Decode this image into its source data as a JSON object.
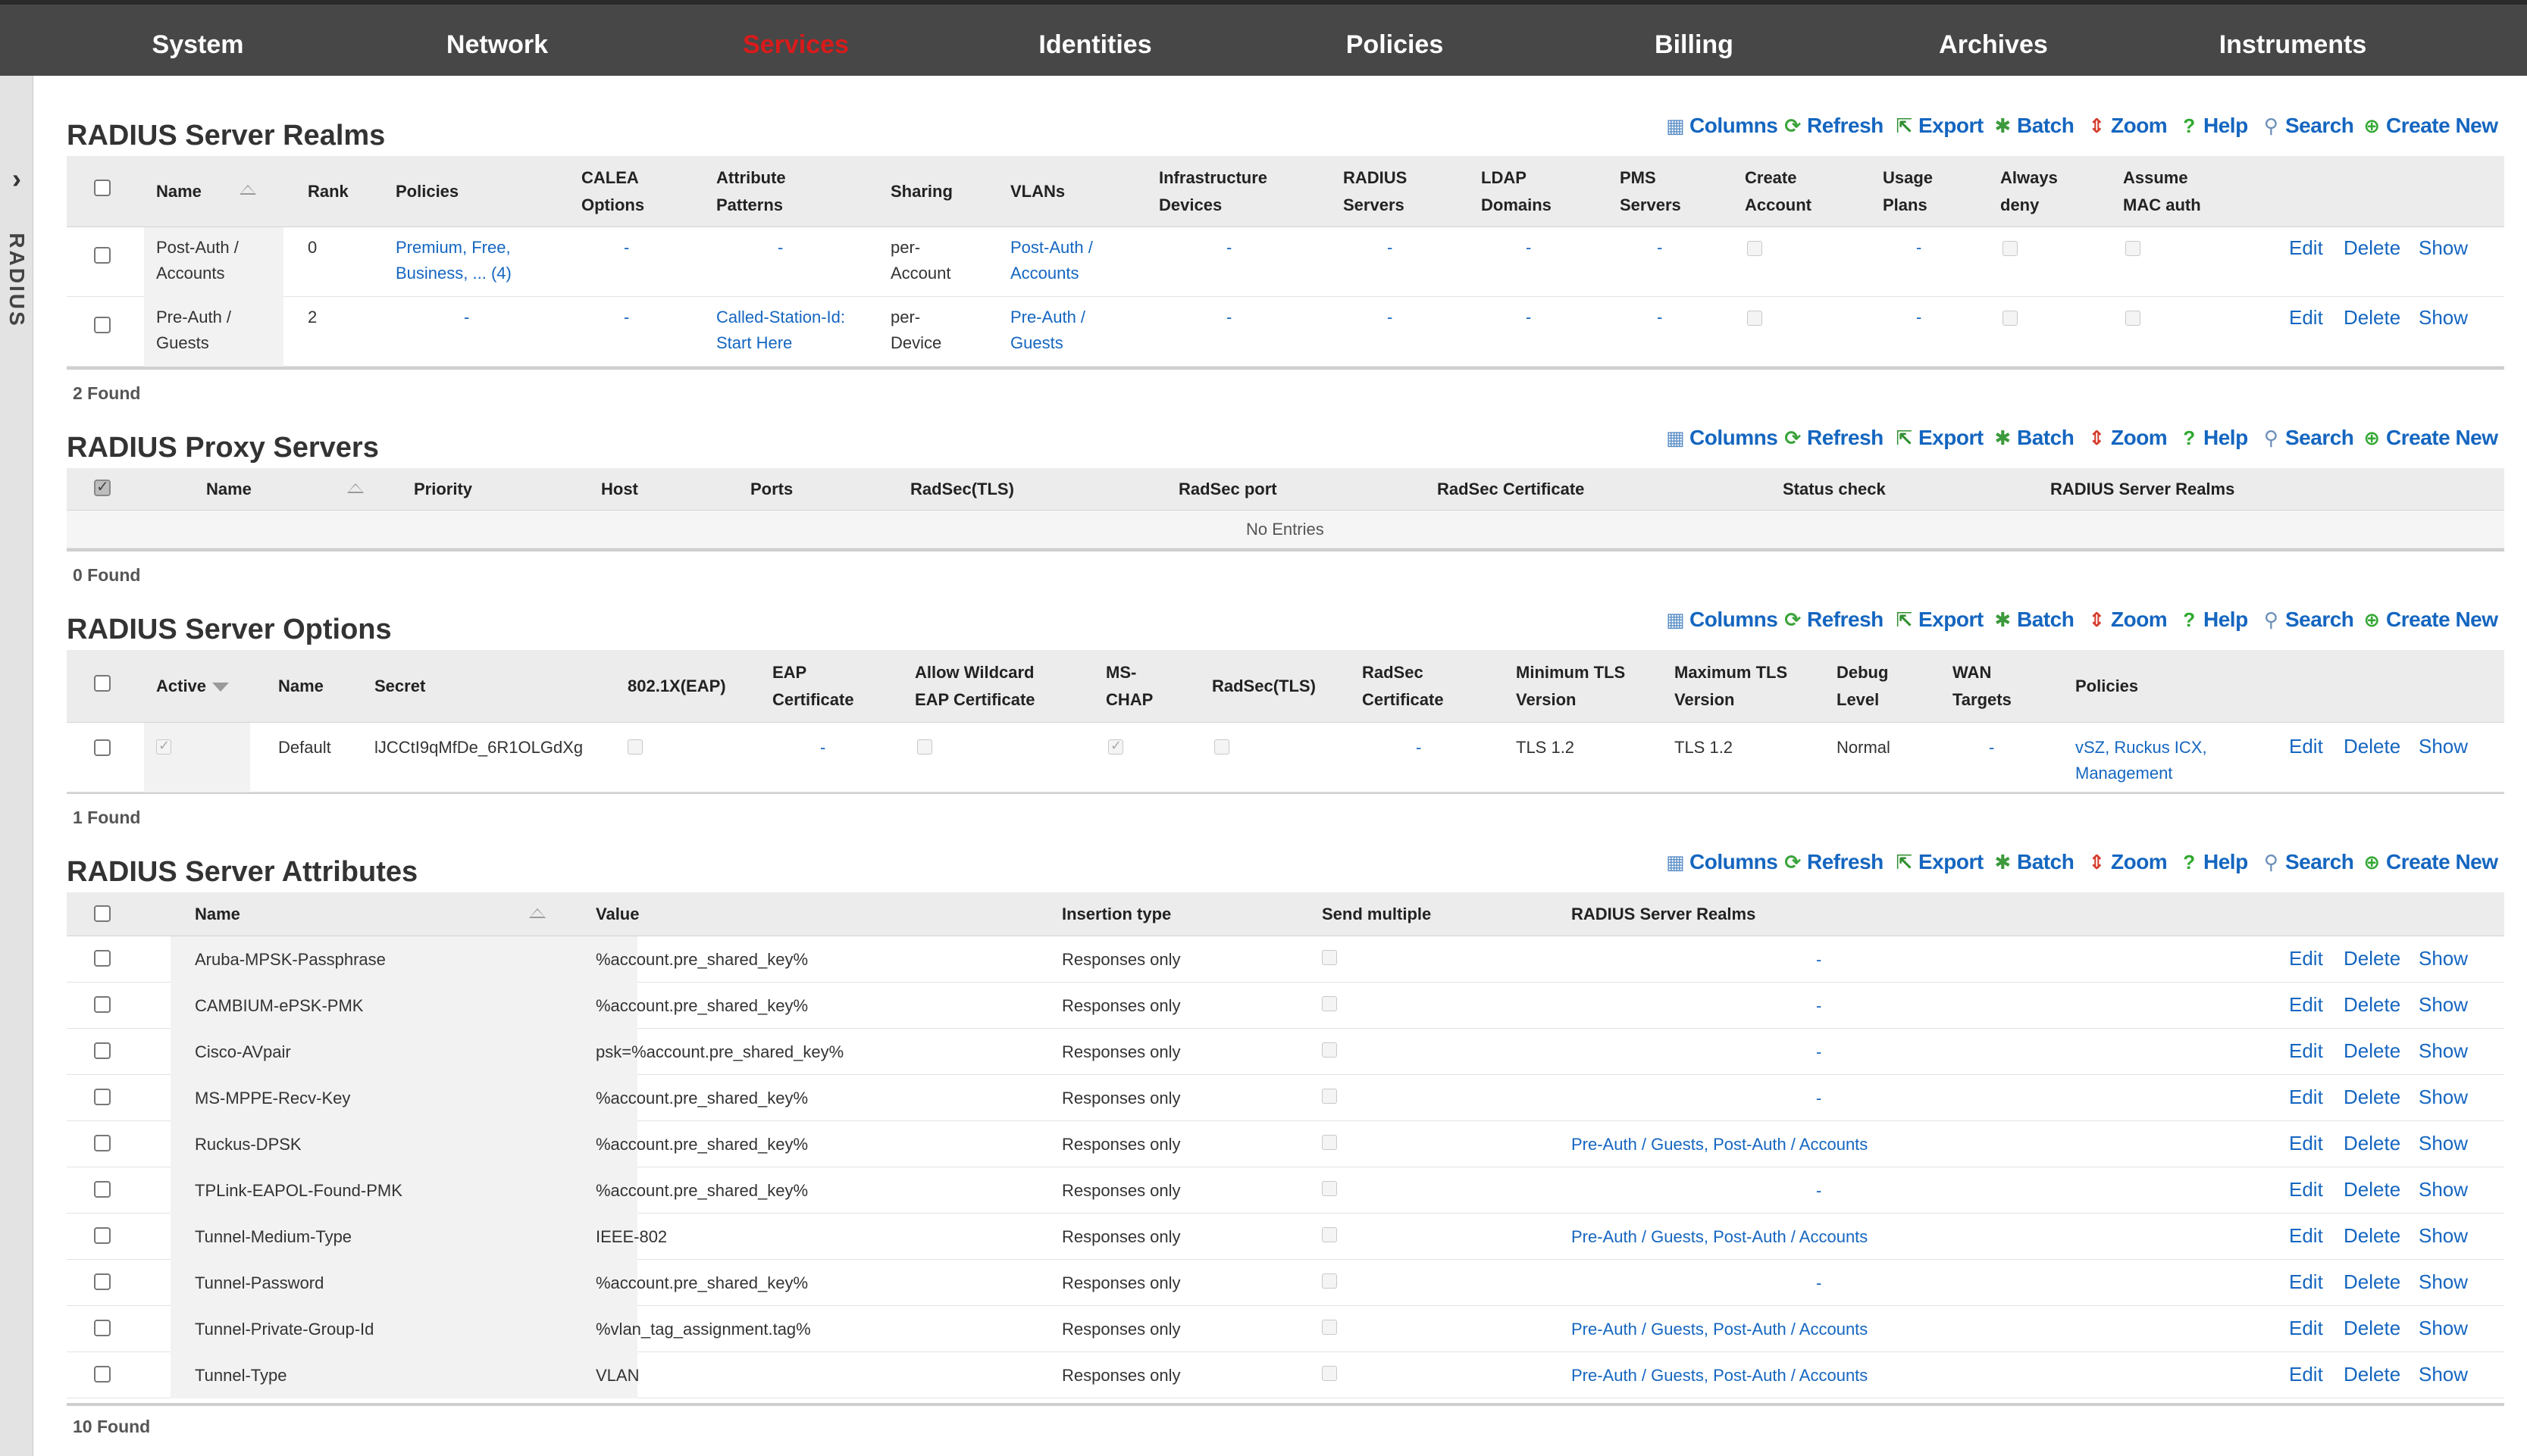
{
  "nav": [
    "System",
    "Network",
    "Services",
    "Identities",
    "Policies",
    "Billing",
    "Archives",
    "Instruments"
  ],
  "nav_active": "Services",
  "sidetab": {
    "label": "RADIUS"
  },
  "toolbar": {
    "columns": "Columns",
    "refresh": "Refresh",
    "export": "Export",
    "batch": "Batch",
    "zoom": "Zoom",
    "help": "Help",
    "search": "Search",
    "create_new": "Create New"
  },
  "actions": {
    "edit": "Edit",
    "delete": "Delete",
    "show": "Show"
  },
  "realms": {
    "title": "RADIUS Server Realms",
    "headers": {
      "name": "Name",
      "rank": "Rank",
      "policies": "Policies",
      "calea_1": "CALEA",
      "calea_2": "Options",
      "attr_1": "Attribute",
      "attr_2": "Patterns",
      "sharing": "Sharing",
      "vlans": "VLANs",
      "infra_1": "Infrastructure",
      "infra_2": "Devices",
      "radius_1": "RADIUS",
      "radius_2": "Servers",
      "ldap_1": "LDAP",
      "ldap_2": "Domains",
      "pms_1": "PMS",
      "pms_2": "Servers",
      "create_1": "Create",
      "create_2": "Account",
      "usage_1": "Usage",
      "usage_2": "Plans",
      "always_1": "Always",
      "always_2": "deny",
      "assume_1": "Assume",
      "assume_2": "MAC auth"
    },
    "rows": [
      {
        "name_1": "Post-Auth /",
        "name_2": "Accounts",
        "rank": "0",
        "policies_1": "Premium, Free,",
        "policies_2": "Business, ... (4)",
        "calea": "-",
        "attr_1": "-",
        "attr_2": "",
        "sharing_1": "per-",
        "sharing_2": "Account",
        "vlans_1": "Post-Auth /",
        "vlans_2": "Accounts",
        "infra": "-",
        "radius": "-",
        "ldap": "-",
        "pms": "-",
        "usage": "-"
      },
      {
        "name_1": "Pre-Auth /",
        "name_2": "Guests",
        "rank": "2",
        "policies_1": "-",
        "policies_2": "",
        "calea": "-",
        "attr_1": "Called-Station-Id:",
        "attr_2": "Start Here",
        "sharing_1": "per-",
        "sharing_2": "Device",
        "vlans_1": "Pre-Auth /",
        "vlans_2": "Guests",
        "infra": "-",
        "radius": "-",
        "ldap": "-",
        "pms": "-",
        "usage": "-"
      }
    ],
    "found": "2 Found"
  },
  "proxy": {
    "title": "RADIUS Proxy Servers",
    "headers": {
      "name": "Name",
      "priority": "Priority",
      "host": "Host",
      "ports": "Ports",
      "radsec": "RadSec(TLS)",
      "radsec_port": "RadSec port",
      "radsec_cert": "RadSec Certificate",
      "status": "Status check",
      "realms": "RADIUS Server Realms"
    },
    "no_entries": "No Entries",
    "found": "0 Found"
  },
  "options": {
    "title": "RADIUS Server Options",
    "headers": {
      "active": "Active",
      "name": "Name",
      "secret": "Secret",
      "eap": "802.1X(EAP)",
      "eapcert_1": "EAP",
      "eapcert_2": "Certificate",
      "wild_1": "Allow Wildcard",
      "wild_2": "EAP Certificate",
      "ms_1": "MS-",
      "ms_2": "CHAP",
      "radsec": "RadSec(TLS)",
      "rcert_1": "RadSec",
      "rcert_2": "Certificate",
      "min_1": "Minimum TLS",
      "min_2": "Version",
      "max_1": "Maximum TLS",
      "max_2": "Version",
      "debug_1": "Debug",
      "debug_2": "Level",
      "wan_1": "WAN",
      "wan_2": "Targets",
      "policies": "Policies"
    },
    "row": {
      "name": "Default",
      "secret": "lJCCtI9qMfDe_6R1OLGdXg",
      "eapcert": "-",
      "radsec_cert": "-",
      "min_tls": "TLS 1.2",
      "max_tls": "TLS 1.2",
      "debug": "Normal",
      "wan": "-",
      "policies_1": "vSZ, Ruckus ICX,",
      "policies_2": "Management"
    },
    "found": "1 Found"
  },
  "attributes": {
    "title": "RADIUS Server Attributes",
    "headers": {
      "name": "Name",
      "value": "Value",
      "insertion": "Insertion type",
      "multiple": "Send multiple",
      "realms": "RADIUS Server Realms"
    },
    "rows": [
      {
        "name": "Aruba-MPSK-Passphrase",
        "value": "%account.pre_shared_key%",
        "insertion": "Responses only",
        "realms": "-"
      },
      {
        "name": "CAMBIUM-ePSK-PMK",
        "value": "%account.pre_shared_key%",
        "insertion": "Responses only",
        "realms": "-"
      },
      {
        "name": "Cisco-AVpair",
        "value": "psk=%account.pre_shared_key%",
        "insertion": "Responses only",
        "realms": "-"
      },
      {
        "name": "MS-MPPE-Recv-Key",
        "value": "%account.pre_shared_key%",
        "insertion": "Responses only",
        "realms": "-"
      },
      {
        "name": "Ruckus-DPSK",
        "value": "%account.pre_shared_key%",
        "insertion": "Responses only",
        "realms": "Pre-Auth / Guests, Post-Auth / Accounts"
      },
      {
        "name": "TPLink-EAPOL-Found-PMK",
        "value": "%account.pre_shared_key%",
        "insertion": "Responses only",
        "realms": "-"
      },
      {
        "name": "Tunnel-Medium-Type",
        "value": "IEEE-802",
        "insertion": "Responses only",
        "realms": "Pre-Auth / Guests, Post-Auth / Accounts"
      },
      {
        "name": "Tunnel-Password",
        "value": "%account.pre_shared_key%",
        "insertion": "Responses only",
        "realms": "-"
      },
      {
        "name": "Tunnel-Private-Group-Id",
        "value": "%vlan_tag_assignment.tag%",
        "insertion": "Responses only",
        "realms": "Pre-Auth / Guests, Post-Auth / Accounts"
      },
      {
        "name": "Tunnel-Type",
        "value": "VLAN",
        "insertion": "Responses only",
        "realms": "Pre-Auth / Guests, Post-Auth / Accounts"
      }
    ],
    "found": "10 Found"
  }
}
